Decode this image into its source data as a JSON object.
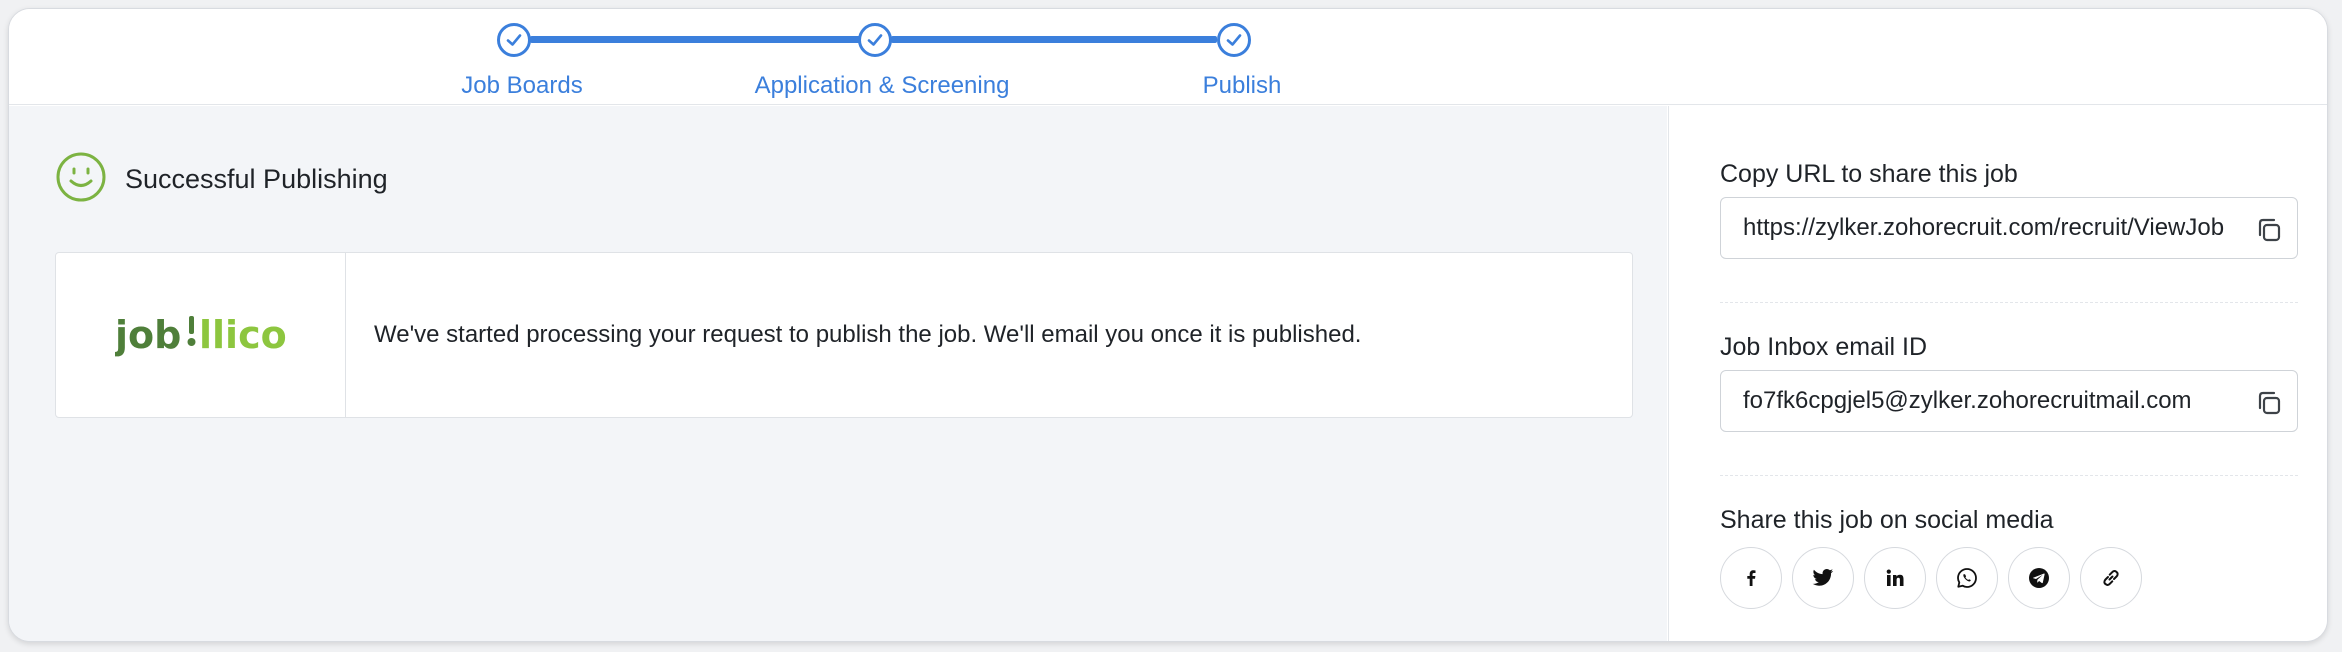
{
  "stepper": {
    "steps": [
      {
        "label": "Job Boards",
        "status": "completed"
      },
      {
        "label": "Application & Screening",
        "status": "completed"
      },
      {
        "label": "Publish",
        "status": "completed"
      }
    ]
  },
  "status": {
    "title": "Successful Publishing",
    "icon": "smile-icon"
  },
  "job_board": {
    "logo_text_dark": "job",
    "logo_text_light": "llico",
    "message": "We've started processing your request to publish the job. We'll email you once it is published."
  },
  "share": {
    "url_label": "Copy URL to share this job",
    "url_value": "https://zylker.zohorecruit.com/recruit/ViewJob",
    "email_label": "Job Inbox email ID",
    "email_value": "fo7fk6cpgjel5@zylker.zohorecruitmail.com",
    "social_label": "Share this job on social media",
    "social_icons": [
      "facebook-icon",
      "twitter-icon",
      "linkedin-icon",
      "whatsapp-icon",
      "telegram-icon",
      "link-icon"
    ]
  },
  "colors": {
    "accent": "#3b7fdc",
    "success": "#7cb342",
    "logo_dark": "#4f7f3a",
    "logo_light": "#8dc63f"
  }
}
